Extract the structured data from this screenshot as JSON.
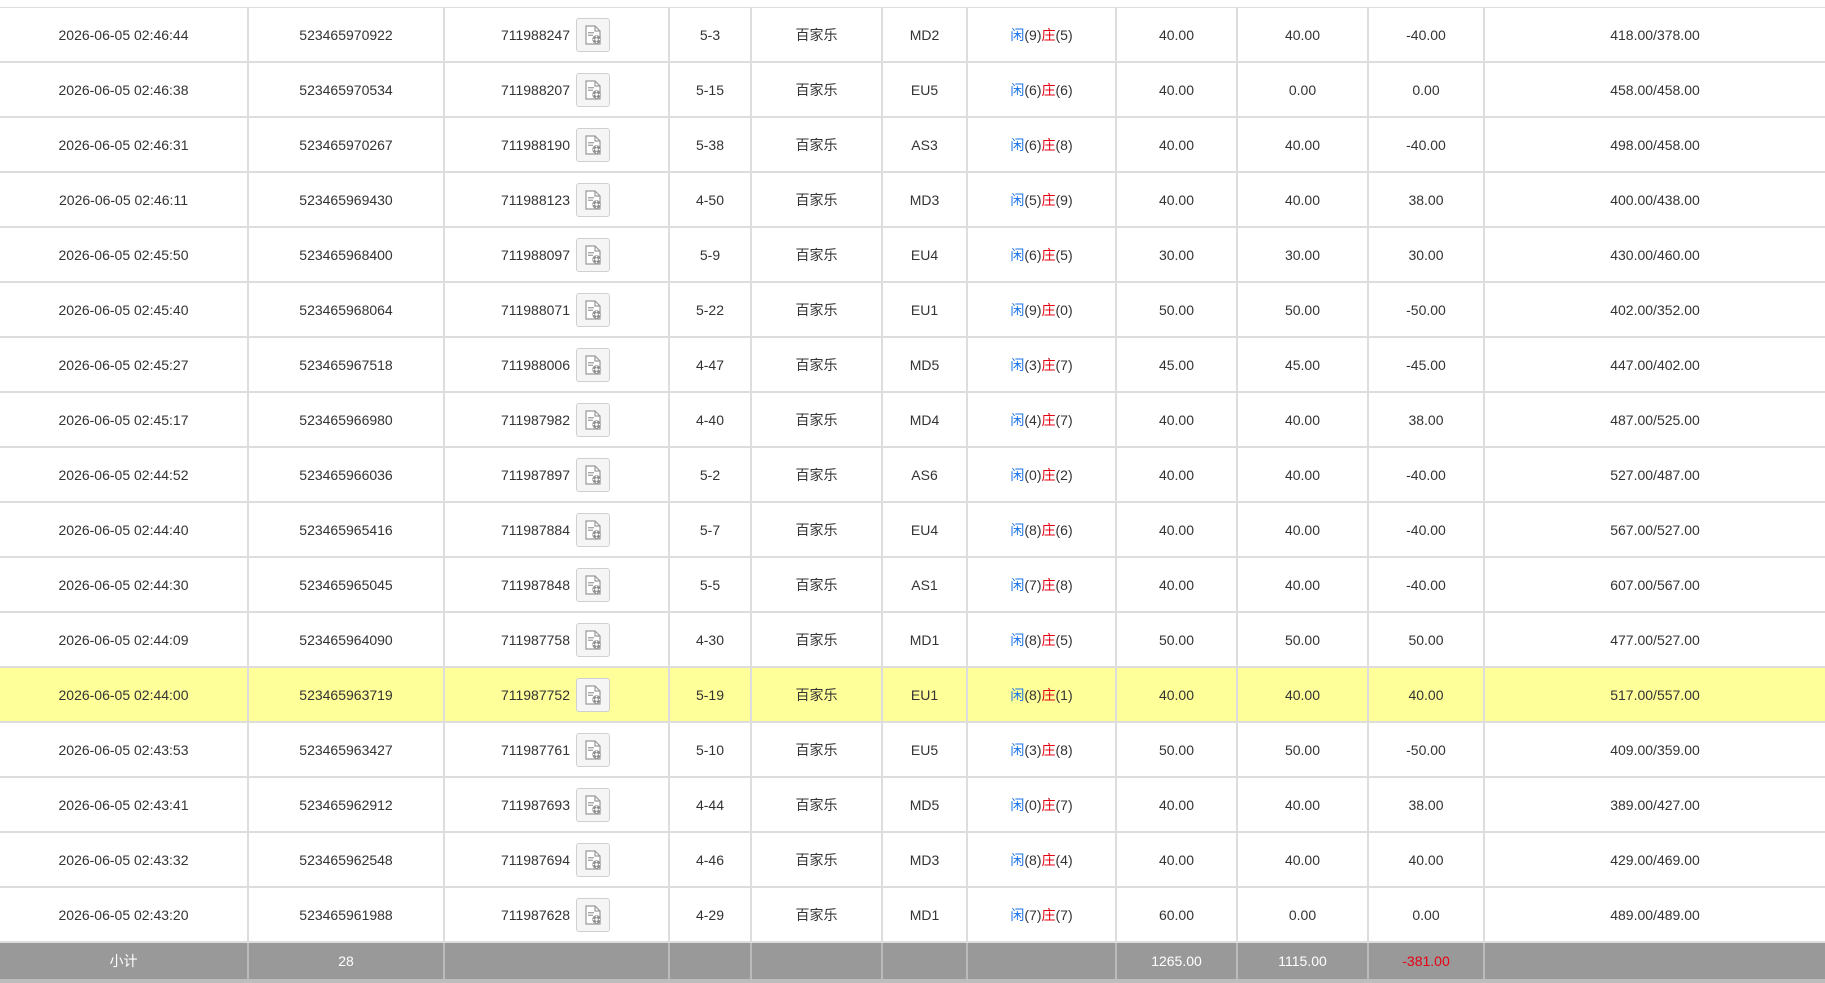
{
  "rows": [
    {
      "time": "2026-06-05 02:46:44",
      "order_id": "523465970922",
      "round": "711988247",
      "shoe": "5-3",
      "game": "百家乐",
      "table": "MD2",
      "player_label": "闲",
      "player_points": "(9)",
      "banker_label": "庄",
      "banker_points": "(5)",
      "bet": "40.00",
      "valid": "40.00",
      "win_loss": "-40.00",
      "win_loss_negative": true,
      "balance": "418.00/378.00"
    },
    {
      "time": "2026-06-05 02:46:38",
      "order_id": "523465970534",
      "round": "711988207",
      "shoe": "5-15",
      "game": "百家乐",
      "table": "EU5",
      "player_label": "闲",
      "player_points": "(6)",
      "banker_label": "庄",
      "banker_points": "(6)",
      "bet": "40.00",
      "valid": "0.00",
      "win_loss": "0.00",
      "win_loss_negative": false,
      "balance": "458.00/458.00"
    },
    {
      "time": "2026-06-05 02:46:31",
      "order_id": "523465970267",
      "round": "711988190",
      "shoe": "5-38",
      "game": "百家乐",
      "table": "AS3",
      "player_label": "闲",
      "player_points": "(6)",
      "banker_label": "庄",
      "banker_points": "(8)",
      "bet": "40.00",
      "valid": "40.00",
      "win_loss": "-40.00",
      "win_loss_negative": true,
      "balance": "498.00/458.00"
    },
    {
      "time": "2026-06-05 02:46:11",
      "order_id": "523465969430",
      "round": "711988123",
      "shoe": "4-50",
      "game": "百家乐",
      "table": "MD3",
      "player_label": "闲",
      "player_points": "(5)",
      "banker_label": "庄",
      "banker_points": "(9)",
      "bet": "40.00",
      "valid": "40.00",
      "win_loss": "38.00",
      "win_loss_negative": false,
      "balance": "400.00/438.00"
    },
    {
      "time": "2026-06-05 02:45:50",
      "order_id": "523465968400",
      "round": "711988097",
      "shoe": "5-9",
      "game": "百家乐",
      "table": "EU4",
      "player_label": "闲",
      "player_points": "(6)",
      "banker_label": "庄",
      "banker_points": "(5)",
      "bet": "30.00",
      "valid": "30.00",
      "win_loss": "30.00",
      "win_loss_negative": false,
      "balance": "430.00/460.00"
    },
    {
      "time": "2026-06-05 02:45:40",
      "order_id": "523465968064",
      "round": "711988071",
      "shoe": "5-22",
      "game": "百家乐",
      "table": "EU1",
      "player_label": "闲",
      "player_points": "(9)",
      "banker_label": "庄",
      "banker_points": "(0)",
      "bet": "50.00",
      "valid": "50.00",
      "win_loss": "-50.00",
      "win_loss_negative": true,
      "balance": "402.00/352.00"
    },
    {
      "time": "2026-06-05 02:45:27",
      "order_id": "523465967518",
      "round": "711988006",
      "shoe": "4-47",
      "game": "百家乐",
      "table": "MD5",
      "player_label": "闲",
      "player_points": "(3)",
      "banker_label": "庄",
      "banker_points": "(7)",
      "bet": "45.00",
      "valid": "45.00",
      "win_loss": "-45.00",
      "win_loss_negative": true,
      "balance": "447.00/402.00"
    },
    {
      "time": "2026-06-05 02:45:17",
      "order_id": "523465966980",
      "round": "711987982",
      "shoe": "4-40",
      "game": "百家乐",
      "table": "MD4",
      "player_label": "闲",
      "player_points": "(4)",
      "banker_label": "庄",
      "banker_points": "(7)",
      "bet": "40.00",
      "valid": "40.00",
      "win_loss": "38.00",
      "win_loss_negative": false,
      "balance": "487.00/525.00"
    },
    {
      "time": "2026-06-05 02:44:52",
      "order_id": "523465966036",
      "round": "711987897",
      "shoe": "5-2",
      "game": "百家乐",
      "table": "AS6",
      "player_label": "闲",
      "player_points": "(0)",
      "banker_label": "庄",
      "banker_points": "(2)",
      "bet": "40.00",
      "valid": "40.00",
      "win_loss": "-40.00",
      "win_loss_negative": true,
      "balance": "527.00/487.00"
    },
    {
      "time": "2026-06-05 02:44:40",
      "order_id": "523465965416",
      "round": "711987884",
      "shoe": "5-7",
      "game": "百家乐",
      "table": "EU4",
      "player_label": "闲",
      "player_points": "(8)",
      "banker_label": "庄",
      "banker_points": "(6)",
      "bet": "40.00",
      "valid": "40.00",
      "win_loss": "-40.00",
      "win_loss_negative": true,
      "balance": "567.00/527.00"
    },
    {
      "time": "2026-06-05 02:44:30",
      "order_id": "523465965045",
      "round": "711987848",
      "shoe": "5-5",
      "game": "百家乐",
      "table": "AS1",
      "player_label": "闲",
      "player_points": "(7)",
      "banker_label": "庄",
      "banker_points": "(8)",
      "bet": "40.00",
      "valid": "40.00",
      "win_loss": "-40.00",
      "win_loss_negative": true,
      "balance": "607.00/567.00"
    },
    {
      "time": "2026-06-05 02:44:09",
      "order_id": "523465964090",
      "round": "711987758",
      "shoe": "4-30",
      "game": "百家乐",
      "table": "MD1",
      "player_label": "闲",
      "player_points": "(8)",
      "banker_label": "庄",
      "banker_points": "(5)",
      "bet": "50.00",
      "valid": "50.00",
      "win_loss": "50.00",
      "win_loss_negative": false,
      "balance": "477.00/527.00"
    },
    {
      "time": "2026-06-05 02:44:00",
      "order_id": "523465963719",
      "round": "711987752",
      "shoe": "5-19",
      "game": "百家乐",
      "table": "EU1",
      "player_label": "闲",
      "player_points": "(8)",
      "banker_label": "庄",
      "banker_points": "(1)",
      "bet": "40.00",
      "valid": "40.00",
      "win_loss": "40.00",
      "win_loss_negative": false,
      "balance": "517.00/557.00",
      "highlighted": true
    },
    {
      "time": "2026-06-05 02:43:53",
      "order_id": "523465963427",
      "round": "711987761",
      "shoe": "5-10",
      "game": "百家乐",
      "table": "EU5",
      "player_label": "闲",
      "player_points": "(3)",
      "banker_label": "庄",
      "banker_points": "(8)",
      "bet": "50.00",
      "valid": "50.00",
      "win_loss": "-50.00",
      "win_loss_negative": true,
      "balance": "409.00/359.00"
    },
    {
      "time": "2026-06-05 02:43:41",
      "order_id": "523465962912",
      "round": "711987693",
      "shoe": "4-44",
      "game": "百家乐",
      "table": "MD5",
      "player_label": "闲",
      "player_points": "(0)",
      "banker_label": "庄",
      "banker_points": "(7)",
      "bet": "40.00",
      "valid": "40.00",
      "win_loss": "38.00",
      "win_loss_negative": false,
      "balance": "389.00/427.00"
    },
    {
      "time": "2026-06-05 02:43:32",
      "order_id": "523465962548",
      "round": "711987694",
      "shoe": "4-46",
      "game": "百家乐",
      "table": "MD3",
      "player_label": "闲",
      "player_points": "(8)",
      "banker_label": "庄",
      "banker_points": "(4)",
      "bet": "40.00",
      "valid": "40.00",
      "win_loss": "40.00",
      "win_loss_negative": false,
      "balance": "429.00/469.00"
    },
    {
      "time": "2026-06-05 02:43:20",
      "order_id": "523465961988",
      "round": "711987628",
      "shoe": "4-29",
      "game": "百家乐",
      "table": "MD1",
      "player_label": "闲",
      "player_points": "(7)",
      "banker_label": "庄",
      "banker_points": "(7)",
      "bet": "60.00",
      "valid": "0.00",
      "win_loss": "0.00",
      "win_loss_negative": false,
      "balance": "489.00/489.00"
    }
  ],
  "subtotal": {
    "label": "小计",
    "count": "28",
    "bet_total": "1265.00",
    "valid_total": "1115.00",
    "win_loss_total": "-381.00"
  },
  "icons": {
    "round_detail": "replay-document-icon"
  },
  "colors": {
    "bet_blue": "#1a73e8",
    "loss_red": "#e60012",
    "highlight_row": "#ffff99",
    "subtotal_bg": "#999999"
  }
}
